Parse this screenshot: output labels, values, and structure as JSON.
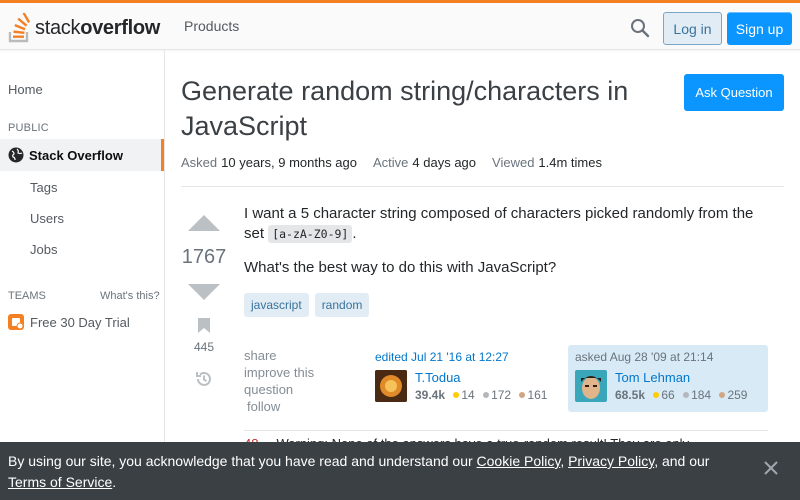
{
  "header": {
    "logo_light": "stack",
    "logo_bold": "overflow",
    "products_label": "Products",
    "login_label": "Log in",
    "signup_label": "Sign up"
  },
  "sidebar": {
    "home": "Home",
    "public_heading": "PUBLIC",
    "active_item": "Stack Overflow",
    "items": [
      "Tags",
      "Users",
      "Jobs"
    ],
    "teams_heading": "TEAMS",
    "whats_this": "What's this?",
    "trial": "Free 30 Day Trial"
  },
  "question": {
    "title": "Generate random string/characters in JavaScript",
    "ask_button": "Ask Question",
    "asked_label": "Asked",
    "asked_value": "10 years, 9 months ago",
    "active_label": "Active",
    "active_value": "4 days ago",
    "viewed_label": "Viewed",
    "viewed_value": "1.4m times",
    "votes": "1767",
    "bookmarks": "445",
    "body_1_pre": "I want a 5 character string composed of characters picked randomly from the set ",
    "body_1_code": "[a-zA-Z0-9]",
    "body_1_post": ".",
    "body_2": "What's the best way to do this with JavaScript?",
    "tags": [
      "javascript",
      "random"
    ],
    "menu": [
      "share",
      "improve this question",
      "follow"
    ]
  },
  "editor": {
    "label": "edited Jul 21 '16 at 12:27",
    "name": "T.Todua",
    "rep": "39.4k",
    "gold": "14",
    "silver": "172",
    "bronze": "161"
  },
  "author": {
    "label": "asked Aug 28 '09 at 21:14",
    "name": "Tom Lehman",
    "rep": "68.5k",
    "gold": "66",
    "silver": "184",
    "bronze": "259"
  },
  "comment": {
    "score": "48",
    "text": "Warning: None of the answers have a true-random result! They are only"
  },
  "cookie": {
    "prefix": "By using our site, you acknowledge that you have read and understand our ",
    "cookie_policy": "Cookie Policy",
    "sep1": ", ",
    "privacy_policy": "Privacy Policy",
    "sep2": ", and our ",
    "terms": "Terms of Service",
    "suffix": "."
  },
  "colors": {
    "accent_orange": "#f48024",
    "primary_blue": "#0a95ff",
    "link_blue": "#0077cc",
    "gold": "#ffcc01",
    "silver": "#b4b8bc",
    "bronze": "#d1a684"
  }
}
